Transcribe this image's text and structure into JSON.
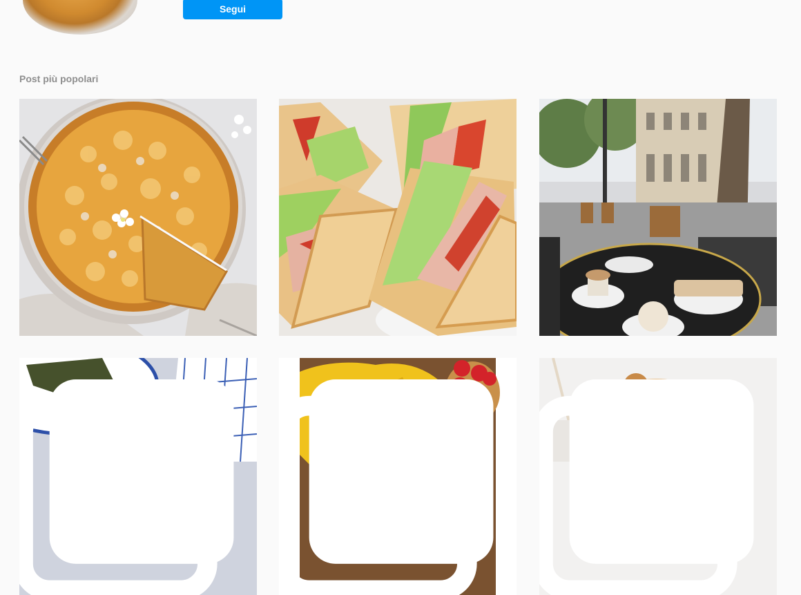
{
  "profile": {
    "follow_label": "Segui"
  },
  "section": {
    "title": "Post più popolari"
  },
  "posts": [
    {
      "subject": "crostata"
    },
    {
      "subject": "club-sandwich"
    },
    {
      "subject": "paris-cafe"
    },
    {
      "subject": "salad-dish",
      "multi": true
    },
    {
      "subject": "pizza-tomatoes",
      "multi": true
    },
    {
      "subject": "caramel-muffin",
      "multi": true
    }
  ]
}
